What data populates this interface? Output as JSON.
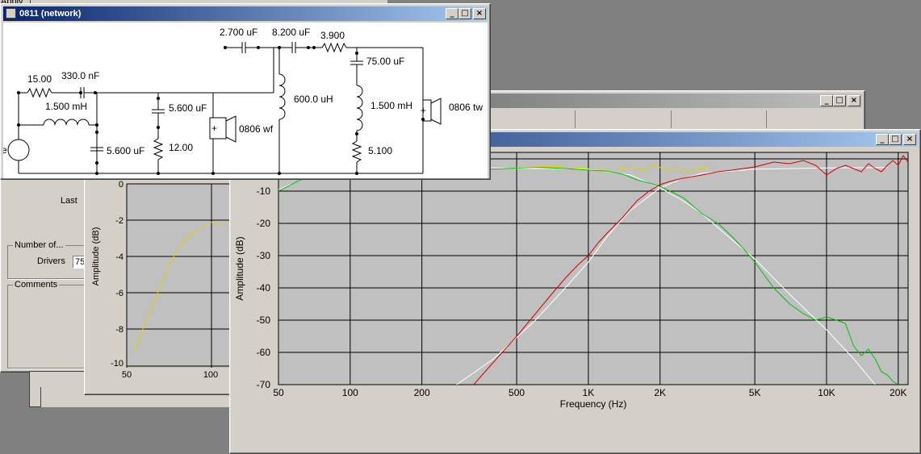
{
  "apply_button": "Apply",
  "network_window": {
    "title": "0811 (network)",
    "components": {
      "c1": "2.700 uF",
      "c2": "8.200 uF",
      "r_series": "3.900",
      "c_tw": "75.00 uF",
      "r1": "15.00",
      "c3": "330.0 nF",
      "l1": "1.500 mH",
      "c4": "5.600 uF",
      "c5": "5.600 uF",
      "r2": "12.00",
      "l2": "600.0 uH",
      "l3": "1.500 mH",
      "r3": "5.100",
      "woofer": "0806 wf",
      "tweeter": "0806 tw",
      "source_fragment": "e",
      "plus": "+"
    }
  },
  "properties_panel": {
    "last_label": "Last",
    "number_of_label": "Number of...",
    "drivers_label": "Drivers",
    "drivers_value": "75",
    "comments_label": "Comments"
  },
  "small_chart": {
    "ylabel": "Amplitude (dB)",
    "y_ticks": [
      "0",
      "-2",
      "-4",
      "-6",
      "-8",
      "-10"
    ],
    "x_ticks": [
      "50",
      "100"
    ]
  },
  "colors": {
    "titlebar_active": "#0a246a",
    "plot_bg": "#c0c0c0",
    "woofer_trace": "#00c000",
    "tweeter_trace": "#d40000",
    "sum_trace": "#e8d000",
    "target_trace": "#ffffff"
  },
  "chart_data": {
    "type": "line",
    "title": "",
    "xlabel": "Frequency (Hz)",
    "ylabel": "Amplitude (dB)",
    "x_scale": "log",
    "xlim": [
      50,
      22000
    ],
    "ylim": [
      -70,
      2
    ],
    "grid": true,
    "x_ticks": [
      {
        "v": 50,
        "label": "50"
      },
      {
        "v": 100,
        "label": "100"
      },
      {
        "v": 200,
        "label": "200"
      },
      {
        "v": 500,
        "label": "500"
      },
      {
        "v": 1000,
        "label": "1K"
      },
      {
        "v": 2000,
        "label": "2K"
      },
      {
        "v": 5000,
        "label": "5K"
      },
      {
        "v": 10000,
        "label": "10K"
      },
      {
        "v": 20000,
        "label": "20K"
      }
    ],
    "y_ticks": [
      {
        "v": 0,
        "label": "0"
      },
      {
        "v": -10,
        "label": "-10"
      },
      {
        "v": -20,
        "label": "-20"
      },
      {
        "v": -30,
        "label": "-30"
      },
      {
        "v": -40,
        "label": "-40"
      },
      {
        "v": -50,
        "label": "-50"
      },
      {
        "v": -60,
        "label": "-60"
      },
      {
        "v": -70,
        "label": "-70"
      }
    ],
    "series": [
      {
        "key": "woofer_target",
        "color": "#ffffff",
        "points": [
          [
            50,
            -9.5
          ],
          [
            70,
            -5
          ],
          [
            100,
            -3
          ],
          [
            300,
            -2.7
          ],
          [
            1000,
            -3.2
          ],
          [
            1500,
            -5
          ],
          [
            2000,
            -9
          ],
          [
            2500,
            -13
          ],
          [
            3000,
            -17
          ],
          [
            4000,
            -25
          ],
          [
            5000,
            -31
          ],
          [
            7000,
            -42
          ],
          [
            10000,
            -53
          ],
          [
            13000,
            -62
          ],
          [
            16000,
            -70
          ]
        ]
      },
      {
        "key": "tweeter_target",
        "color": "#ffffff",
        "points": [
          [
            280,
            -70
          ],
          [
            400,
            -62
          ],
          [
            600,
            -50
          ],
          [
            800,
            -40
          ],
          [
            1000,
            -32
          ],
          [
            1200,
            -24
          ],
          [
            1500,
            -16
          ],
          [
            2000,
            -9
          ],
          [
            2500,
            -6
          ],
          [
            3000,
            -4.5
          ],
          [
            5000,
            -3.2
          ],
          [
            10000,
            -2.8
          ],
          [
            18000,
            -2.7
          ]
        ]
      },
      {
        "key": "woofer",
        "color": "#00c000",
        "points": [
          [
            50,
            -10
          ],
          [
            60,
            -7
          ],
          [
            70,
            -5
          ],
          [
            80,
            -4
          ],
          [
            100,
            -3
          ],
          [
            150,
            -2.8
          ],
          [
            200,
            -3
          ],
          [
            300,
            -2.5
          ],
          [
            400,
            -3.2
          ],
          [
            600,
            -2.6
          ],
          [
            800,
            -3
          ],
          [
            1000,
            -3.5
          ],
          [
            1200,
            -3.8
          ],
          [
            1400,
            -4.8
          ],
          [
            1600,
            -6.5
          ],
          [
            1800,
            -7.5
          ],
          [
            2000,
            -8.5
          ],
          [
            2500,
            -12
          ],
          [
            3000,
            -17
          ],
          [
            3500,
            -20
          ],
          [
            4000,
            -24
          ],
          [
            4500,
            -28
          ],
          [
            5000,
            -32
          ],
          [
            6000,
            -40
          ],
          [
            7000,
            -45
          ],
          [
            8000,
            -48
          ],
          [
            9000,
            -50
          ],
          [
            10000,
            -49
          ],
          [
            11000,
            -50
          ],
          [
            12000,
            -51
          ],
          [
            13000,
            -58
          ],
          [
            14000,
            -61
          ],
          [
            15000,
            -59
          ],
          [
            16000,
            -62
          ],
          [
            17000,
            -66
          ],
          [
            18000,
            -67
          ],
          [
            19000,
            -69
          ],
          [
            20000,
            -70
          ]
        ]
      },
      {
        "key": "tweeter",
        "color": "#d40000",
        "points": [
          [
            330,
            -70
          ],
          [
            400,
            -63
          ],
          [
            500,
            -55
          ],
          [
            600,
            -48
          ],
          [
            700,
            -42
          ],
          [
            800,
            -37
          ],
          [
            900,
            -33
          ],
          [
            1000,
            -30
          ],
          [
            1100,
            -26
          ],
          [
            1200,
            -23
          ],
          [
            1400,
            -18
          ],
          [
            1600,
            -13
          ],
          [
            1800,
            -10
          ],
          [
            2000,
            -8
          ],
          [
            2200,
            -7
          ],
          [
            2500,
            -6
          ],
          [
            3000,
            -5
          ],
          [
            3500,
            -4
          ],
          [
            4000,
            -3.5
          ],
          [
            5000,
            -2.5
          ],
          [
            6000,
            -1
          ],
          [
            7000,
            -1.5
          ],
          [
            8000,
            -0.5
          ],
          [
            9000,
            -2
          ],
          [
            10000,
            -5
          ],
          [
            11000,
            -3
          ],
          [
            12000,
            -2
          ],
          [
            14000,
            -4
          ],
          [
            15000,
            -1.5
          ],
          [
            16000,
            -3
          ],
          [
            17000,
            -4
          ],
          [
            18000,
            -2
          ],
          [
            19000,
            -0.5
          ],
          [
            20000,
            -2
          ],
          [
            21000,
            1
          ],
          [
            22000,
            -1
          ]
        ]
      },
      {
        "key": "sum",
        "color": "#e8d000",
        "points": [
          [
            500,
            -2.7
          ],
          [
            700,
            -2.3
          ],
          [
            900,
            -2.8
          ],
          [
            1100,
            -3.3
          ],
          [
            1300,
            -3.1
          ],
          [
            1500,
            -2.6
          ],
          [
            1700,
            -3.5
          ],
          [
            1900,
            -1.8
          ],
          [
            2100,
            -3.5
          ],
          [
            2300,
            -2.5
          ],
          [
            2600,
            -4
          ],
          [
            2900,
            -3
          ],
          [
            3300,
            -2.6
          ]
        ]
      }
    ]
  }
}
